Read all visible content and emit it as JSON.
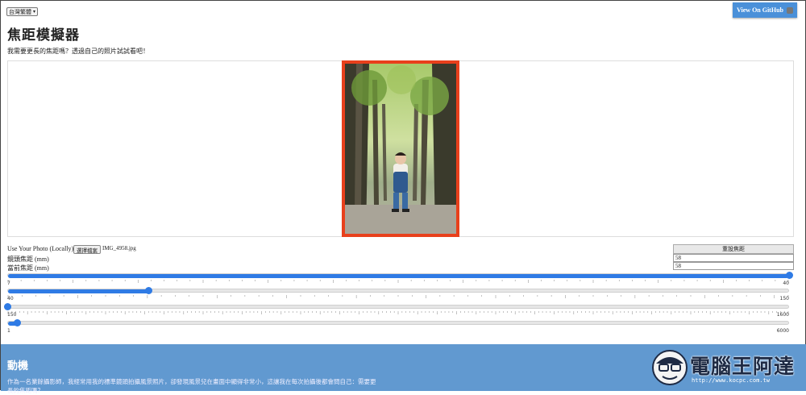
{
  "language": {
    "selected": "台灣繁體"
  },
  "github": {
    "label": "View On GitHub"
  },
  "page": {
    "title": "焦距模擬器",
    "subtitle": "我需要更長的焦距嗎？透過自己的照片試試看吧！"
  },
  "controls": {
    "photo_label": "Use Your Photo (Locally)",
    "file_button": "選擇檔案",
    "file_name": "IMG_4958.jpg",
    "lens_focal_label": "鏡頭焦距 (mm)",
    "current_focal_label": "當前焦距 (mm)",
    "reset_label": "重設焦距",
    "lens_focal_value": "58",
    "current_focal_value": "58"
  },
  "sliders": [
    {
      "min": "7",
      "max": "40",
      "fraction": 1.0
    },
    {
      "min": "40",
      "max": "150",
      "fraction": 0.18
    },
    {
      "min": "150",
      "max": "1600",
      "fraction": 0.0
    },
    {
      "min": "1",
      "max": "6000",
      "fraction": 0.012
    }
  ],
  "motive": {
    "heading": "動機",
    "text": "作為一名業餘攝影師，我經常用我的標準鏡頭拍攝風景照片，卻發現風景兒在畫面中顯得非常小，這讓我在每次拍攝後都會問自己：需要更長的焦距嗎？"
  },
  "watermark": {
    "brand": "電腦王阿達",
    "url": "http://www.kocpc.com.tw"
  },
  "colors": {
    "accent": "#2f7be5",
    "frame": "#e8401c",
    "section_bg": "#6199d0",
    "github_btn": "#4a90d9"
  }
}
